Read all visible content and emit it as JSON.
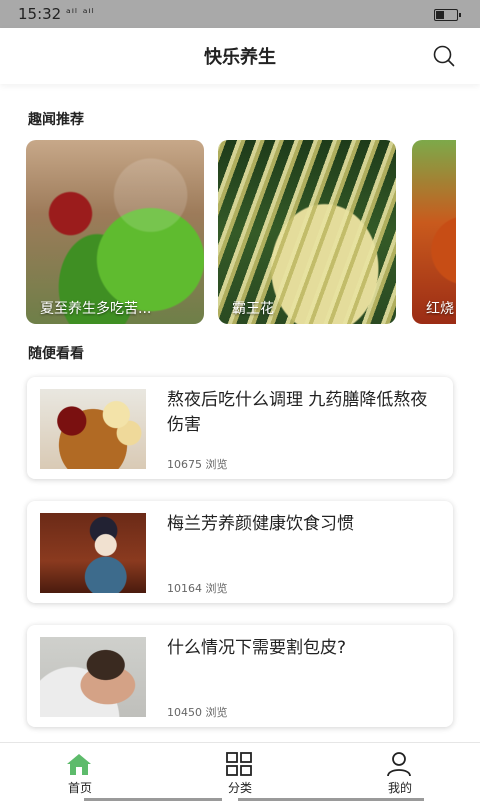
{
  "status_bar": {
    "time": "15:32",
    "signal": "ᵃᴵˡ ᵃᴵˡ"
  },
  "header": {
    "title": "快乐养生",
    "search_icon": "search-icon"
  },
  "sections": {
    "featured_title": "趣闻推荐",
    "browse_title": "随便看看"
  },
  "featured": [
    {
      "label": "夏至养生多吃苦..."
    },
    {
      "label": "霸王花"
    },
    {
      "label": "红烧"
    }
  ],
  "articles": [
    {
      "title": "熬夜后吃什么调理 九药膳降低熬夜伤害",
      "views": "10675 浏览"
    },
    {
      "title": "梅兰芳养颜健康饮食习惯",
      "views": "10164 浏览"
    },
    {
      "title": "什么情况下需要割包皮?",
      "views": "10450 浏览"
    }
  ],
  "tabbar": {
    "tabs": [
      {
        "label": "首页",
        "icon": "home-icon",
        "active": true
      },
      {
        "label": "分类",
        "icon": "grid-icon",
        "active": false
      },
      {
        "label": "我的",
        "icon": "user-icon",
        "active": false
      }
    ]
  },
  "colors": {
    "accent": "#5dbb6b",
    "status_bar": "#a9a9a9"
  }
}
